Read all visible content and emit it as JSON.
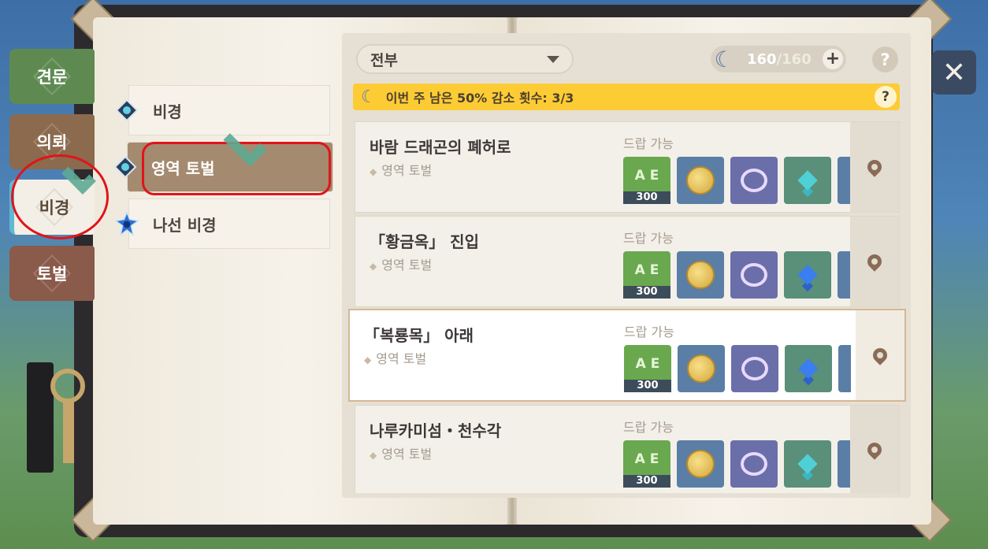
{
  "side_tabs": [
    {
      "label": "견문"
    },
    {
      "label": "의뢰"
    },
    {
      "label": "비경"
    },
    {
      "label": "토벌"
    }
  ],
  "categories": [
    {
      "label": "비경",
      "icon": "domain-icon"
    },
    {
      "label": "영역 토벌",
      "icon": "domain-icon",
      "selected": true
    },
    {
      "label": "나선 비경",
      "icon": "spiral-abyss-icon"
    }
  ],
  "filter": {
    "selected": "전부"
  },
  "resin": {
    "current": "160",
    "max": "/160",
    "plus": "+"
  },
  "help_label": "?",
  "banner": {
    "text": "이번 주 남은 50% 감소 횟수: 3/3"
  },
  "close_label": "✕",
  "rows": [
    {
      "name": "바람 드래곤의 폐허로",
      "sub": "영역 토벌",
      "drop": "드랍 가능",
      "exp_count": "300",
      "gem_color": "cyan"
    },
    {
      "name": "「황금옥」 진입",
      "sub": "영역 토벌",
      "drop": "드랍 가능",
      "exp_count": "300",
      "gem_color": "blue"
    },
    {
      "name": "「복룡목」 아래",
      "sub": "영역 토벌",
      "drop": "드랍 가능",
      "exp_count": "300",
      "gem_color": "blue",
      "selected": true
    },
    {
      "name": "나루카미섬・천수각",
      "sub": "영역 토벌",
      "drop": "드랍 가능",
      "exp_count": "300",
      "gem_color": "cyan"
    }
  ],
  "exp_letters": "A E",
  "colors": {
    "banner": "#fdcc35",
    "selected_category": "#a48a6e",
    "annotation_red": "#e0141b",
    "annotation_check": "#5faa93"
  }
}
